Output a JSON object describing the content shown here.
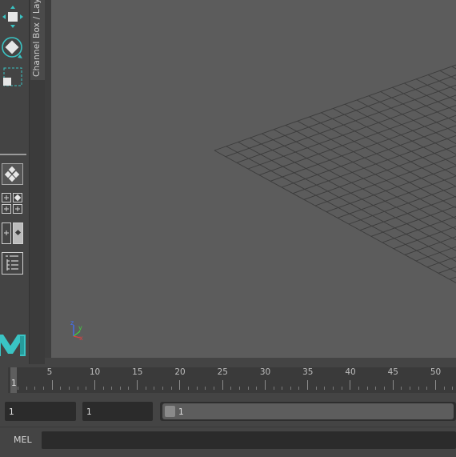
{
  "channel_box": {
    "tab_label": "Channel Box / Layer Editor"
  },
  "timeline": {
    "tick_labels": [
      "5",
      "10",
      "15",
      "20",
      "25",
      "30",
      "35",
      "40",
      "45",
      "50"
    ],
    "current_frame": "1"
  },
  "range": {
    "start_time": "1",
    "playback_start": "1",
    "slider_value": "1"
  },
  "command_line": {
    "label": "MEL",
    "value": ""
  },
  "icons": {
    "toolbox": [
      "move-icon",
      "rotate-icon",
      "scale-icon"
    ],
    "layouts": [
      "single-perspective-layout-icon",
      "four-view-layout-icon",
      "two-view-layout-icon",
      "outliner-layout-icon"
    ],
    "logo": "maya-logo",
    "axis": "view-axis-indicator"
  },
  "colors": {
    "viewport_bg": "#5c5c5c",
    "grid_line": "#3c3c3c",
    "logo_teal": "#3ac4c4",
    "axis_x": "#e04040",
    "axis_y": "#40d040",
    "axis_z": "#4070ff"
  }
}
